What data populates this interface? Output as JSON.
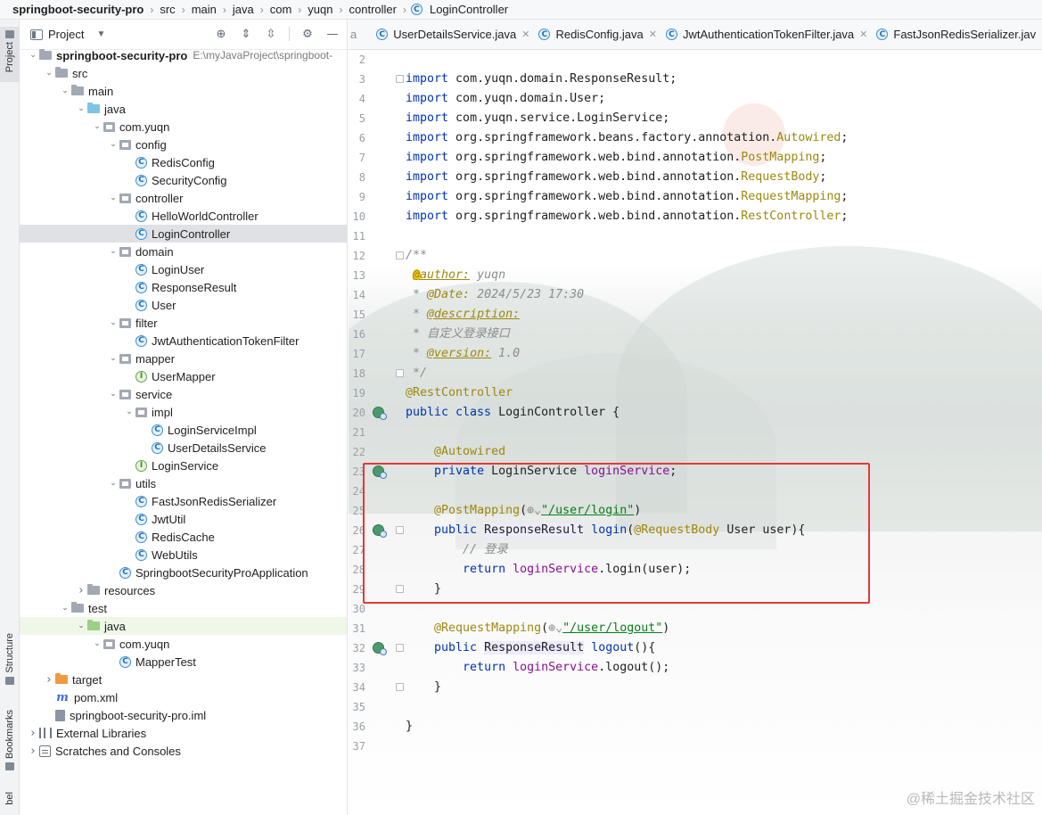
{
  "breadcrumb": [
    "springboot-security-pro",
    "src",
    "main",
    "java",
    "com",
    "yuqn",
    "controller",
    "LoginController"
  ],
  "sidebar_strip": {
    "project": "Project",
    "structure": "Structure",
    "bookmarks": "Bookmarks",
    "bel": "bel"
  },
  "project_panel": {
    "title": "Project",
    "tree": [
      {
        "label": "springboot-security-pro",
        "path": "E:\\myJavaProject\\springboot-",
        "depth": 0,
        "arrow": "open",
        "icon": "folder",
        "bold": true
      },
      {
        "label": "src",
        "depth": 1,
        "arrow": "open",
        "icon": "folder"
      },
      {
        "label": "main",
        "depth": 2,
        "arrow": "open",
        "icon": "folder"
      },
      {
        "label": "java",
        "depth": 3,
        "arrow": "open",
        "icon": "folder-blue"
      },
      {
        "label": "com.yuqn",
        "depth": 4,
        "arrow": "open",
        "icon": "package"
      },
      {
        "label": "config",
        "depth": 5,
        "arrow": "open",
        "icon": "package"
      },
      {
        "label": "RedisConfig",
        "depth": 6,
        "arrow": "none",
        "icon": "class"
      },
      {
        "label": "SecurityConfig",
        "depth": 6,
        "arrow": "none",
        "icon": "class"
      },
      {
        "label": "controller",
        "depth": 5,
        "arrow": "open",
        "icon": "package"
      },
      {
        "label": "HelloWorldController",
        "depth": 6,
        "arrow": "none",
        "icon": "class"
      },
      {
        "label": "LoginController",
        "depth": 6,
        "arrow": "none",
        "icon": "class",
        "selected": true
      },
      {
        "label": "domain",
        "depth": 5,
        "arrow": "open",
        "icon": "package"
      },
      {
        "label": "LoginUser",
        "depth": 6,
        "arrow": "none",
        "icon": "class"
      },
      {
        "label": "ResponseResult",
        "depth": 6,
        "arrow": "none",
        "icon": "class"
      },
      {
        "label": "User",
        "depth": 6,
        "arrow": "none",
        "icon": "class"
      },
      {
        "label": "filter",
        "depth": 5,
        "arrow": "open",
        "icon": "package"
      },
      {
        "label": "JwtAuthenticationTokenFilter",
        "depth": 6,
        "arrow": "none",
        "icon": "class"
      },
      {
        "label": "mapper",
        "depth": 5,
        "arrow": "open",
        "icon": "package"
      },
      {
        "label": "UserMapper",
        "depth": 6,
        "arrow": "none",
        "icon": "interface"
      },
      {
        "label": "service",
        "depth": 5,
        "arrow": "open",
        "icon": "package"
      },
      {
        "label": "impl",
        "depth": 6,
        "arrow": "open",
        "icon": "package"
      },
      {
        "label": "LoginServiceImpl",
        "depth": 7,
        "arrow": "none",
        "icon": "class"
      },
      {
        "label": "UserDetailsService",
        "depth": 7,
        "arrow": "none",
        "icon": "class"
      },
      {
        "label": "LoginService",
        "depth": 6,
        "arrow": "none",
        "icon": "interface"
      },
      {
        "label": "utils",
        "depth": 5,
        "arrow": "open",
        "icon": "package"
      },
      {
        "label": "FastJsonRedisSerializer",
        "depth": 6,
        "arrow": "none",
        "icon": "class"
      },
      {
        "label": "JwtUtil",
        "depth": 6,
        "arrow": "none",
        "icon": "class"
      },
      {
        "label": "RedisCache",
        "depth": 6,
        "arrow": "none",
        "icon": "class"
      },
      {
        "label": "WebUtils",
        "depth": 6,
        "arrow": "none",
        "icon": "class"
      },
      {
        "label": "SpringbootSecurityProApplication",
        "depth": 5,
        "arrow": "none",
        "icon": "class"
      },
      {
        "label": "resources",
        "depth": 3,
        "arrow": "closed",
        "icon": "folder-res"
      },
      {
        "label": "test",
        "depth": 2,
        "arrow": "open",
        "icon": "folder"
      },
      {
        "label": "java",
        "depth": 3,
        "arrow": "open",
        "icon": "folder-green",
        "test": true
      },
      {
        "label": "com.yuqn",
        "depth": 4,
        "arrow": "open",
        "icon": "package"
      },
      {
        "label": "MapperTest",
        "depth": 5,
        "arrow": "none",
        "icon": "class"
      },
      {
        "label": "target",
        "depth": 1,
        "arrow": "closed",
        "icon": "folder-orange"
      },
      {
        "label": "pom.xml",
        "depth": 1,
        "arrow": "none",
        "icon": "maven"
      },
      {
        "label": "springboot-security-pro.iml",
        "depth": 1,
        "arrow": "none",
        "icon": "iml"
      },
      {
        "label": "External Libraries",
        "depth": 0,
        "arrow": "closed",
        "icon": "libs"
      },
      {
        "label": "Scratches and Consoles",
        "depth": 0,
        "arrow": "closed",
        "icon": "scratch"
      }
    ]
  },
  "editor_tabs": {
    "first_partial": "a",
    "tabs": [
      {
        "label": "UserDetailsService.java"
      },
      {
        "label": "RedisConfig.java"
      },
      {
        "label": "JwtAuthenticationTokenFilter.java"
      },
      {
        "label": "FastJsonRedisSerializer.jav"
      }
    ]
  },
  "code_lines": [
    {
      "n": "2",
      "tokens": []
    },
    {
      "n": "3",
      "tokens": [
        [
          "kw",
          "import"
        ],
        [
          "",
          " com.yuqn.domain.ResponseResult;"
        ]
      ]
    },
    {
      "n": "4",
      "tokens": [
        [
          "kw",
          "import"
        ],
        [
          "",
          " com.yuqn.domain.User;"
        ]
      ]
    },
    {
      "n": "5",
      "tokens": [
        [
          "kw",
          "import"
        ],
        [
          "",
          " com.yuqn.service.LoginService;"
        ]
      ]
    },
    {
      "n": "6",
      "tokens": [
        [
          "kw",
          "import"
        ],
        [
          "",
          " org.springframework.beans.factory.annotation."
        ],
        [
          "gold",
          "Autowired"
        ],
        [
          "",
          ";"
        ]
      ]
    },
    {
      "n": "7",
      "tokens": [
        [
          "kw",
          "import"
        ],
        [
          "",
          " org.springframework.web.bind.annotation."
        ],
        [
          "gold",
          "PostMapping"
        ],
        [
          "",
          ";"
        ]
      ]
    },
    {
      "n": "8",
      "tokens": [
        [
          "kw",
          "import"
        ],
        [
          "",
          " org.springframework.web.bind.annotation."
        ],
        [
          "gold",
          "RequestBody"
        ],
        [
          "",
          ";"
        ]
      ]
    },
    {
      "n": "9",
      "tokens": [
        [
          "kw",
          "import"
        ],
        [
          "",
          " org.springframework.web.bind.annotation."
        ],
        [
          "gold",
          "RequestMapping"
        ],
        [
          "",
          ";"
        ]
      ]
    },
    {
      "n": "10",
      "tokens": [
        [
          "kw",
          "import"
        ],
        [
          "",
          " org.springframework.web.bind.annotation."
        ],
        [
          "gold",
          "RestController"
        ],
        [
          "",
          ";"
        ]
      ]
    },
    {
      "n": "11",
      "tokens": []
    },
    {
      "n": "12",
      "tokens": [
        [
          "cmt",
          "/**"
        ]
      ]
    },
    {
      "n": "13",
      "tokens": [
        [
          "cmt",
          " "
        ],
        [
          "doctag",
          "@author:"
        ],
        [
          "cmt",
          " yuqn"
        ]
      ]
    },
    {
      "n": "14",
      "tokens": [
        [
          "cmt",
          " * "
        ],
        [
          "doctag-plain",
          "@Date:"
        ],
        [
          "cmt",
          " 2024/5/23 17:30"
        ]
      ]
    },
    {
      "n": "15",
      "tokens": [
        [
          "cmt",
          " * "
        ],
        [
          "doctag",
          "@description:"
        ]
      ]
    },
    {
      "n": "16",
      "tokens": [
        [
          "cmt",
          " * 自定义登录接口"
        ]
      ]
    },
    {
      "n": "17",
      "tokens": [
        [
          "cmt",
          " * "
        ],
        [
          "doctag",
          "@version:"
        ],
        [
          "cmt",
          " 1.0"
        ]
      ]
    },
    {
      "n": "18",
      "tokens": [
        [
          "cmt",
          " */"
        ]
      ]
    },
    {
      "n": "19",
      "tokens": [
        [
          "ann",
          "@RestController"
        ]
      ]
    },
    {
      "n": "20",
      "tokens": [
        [
          "kw",
          "public class"
        ],
        [
          "",
          " LoginController {"
        ]
      ]
    },
    {
      "n": "21",
      "tokens": []
    },
    {
      "n": "22",
      "tokens": [
        [
          "",
          "    "
        ],
        [
          "ann",
          "@Autowired"
        ]
      ]
    },
    {
      "n": "23",
      "tokens": [
        [
          "",
          "    "
        ],
        [
          "kw",
          "private"
        ],
        [
          "",
          " LoginService "
        ],
        [
          "fld",
          "loginService"
        ],
        [
          "",
          ";"
        ]
      ]
    },
    {
      "n": "24",
      "tokens": []
    },
    {
      "n": "25",
      "tokens": [
        [
          "",
          "    "
        ],
        [
          "ann",
          "@PostMapping"
        ],
        [
          "",
          "("
        ],
        [
          "cmt",
          "⊕⌄"
        ],
        [
          "str",
          "\"/user/login\""
        ],
        [
          "",
          ")"
        ]
      ]
    },
    {
      "n": "26",
      "tokens": [
        [
          "",
          "    "
        ],
        [
          "kw",
          "public"
        ],
        [
          "",
          " "
        ],
        [
          "hl",
          "ResponseResult"
        ],
        [
          "",
          " "
        ],
        [
          "kw",
          "login"
        ],
        [
          "",
          "("
        ],
        [
          "ann",
          "@RequestBody"
        ],
        [
          "",
          " User user){"
        ]
      ]
    },
    {
      "n": "27",
      "tokens": [
        [
          "",
          "        "
        ],
        [
          "cmt",
          "// 登录"
        ]
      ]
    },
    {
      "n": "28",
      "tokens": [
        [
          "",
          "        "
        ],
        [
          "kw",
          "return"
        ],
        [
          "",
          " "
        ],
        [
          "fld",
          "loginService"
        ],
        [
          "",
          ".login(user);"
        ]
      ]
    },
    {
      "n": "29",
      "tokens": [
        [
          "",
          "    }"
        ]
      ]
    },
    {
      "n": "30",
      "tokens": []
    },
    {
      "n": "31",
      "tokens": [
        [
          "",
          "    "
        ],
        [
          "ann",
          "@RequestMapping"
        ],
        [
          "",
          "("
        ],
        [
          "cmt",
          "⊕⌄"
        ],
        [
          "str",
          "\"/user/logout\""
        ],
        [
          "",
          ")"
        ]
      ]
    },
    {
      "n": "32",
      "tokens": [
        [
          "",
          "    "
        ],
        [
          "kw",
          "public"
        ],
        [
          "",
          " "
        ],
        [
          "hl",
          "ResponseResult"
        ],
        [
          "",
          " "
        ],
        [
          "kw",
          "logout"
        ],
        [
          "",
          "(){"
        ]
      ]
    },
    {
      "n": "33",
      "tokens": [
        [
          "",
          "        "
        ],
        [
          "kw",
          "return"
        ],
        [
          "",
          " "
        ],
        [
          "fld",
          "loginService"
        ],
        [
          "",
          ".logout();"
        ]
      ]
    },
    {
      "n": "34",
      "tokens": [
        [
          "",
          "    }"
        ]
      ]
    },
    {
      "n": "35",
      "tokens": []
    },
    {
      "n": "36",
      "tokens": [
        [
          "",
          "}"
        ]
      ]
    },
    {
      "n": "37",
      "tokens": []
    }
  ],
  "gutter_markers": [
    "20",
    "23",
    "26",
    "32"
  ],
  "fold_markers": [
    "3",
    "12",
    "18",
    "26",
    "29",
    "32",
    "34"
  ],
  "watermark": "@稀土掘金技术社区",
  "colors": {
    "keyword": "#0033b3",
    "annotation": "#9e880d",
    "string": "#067d17",
    "field": "#871094",
    "comment": "#8c8c8c",
    "highlight_box": "#e53935",
    "selection": "#dfe1e5"
  }
}
